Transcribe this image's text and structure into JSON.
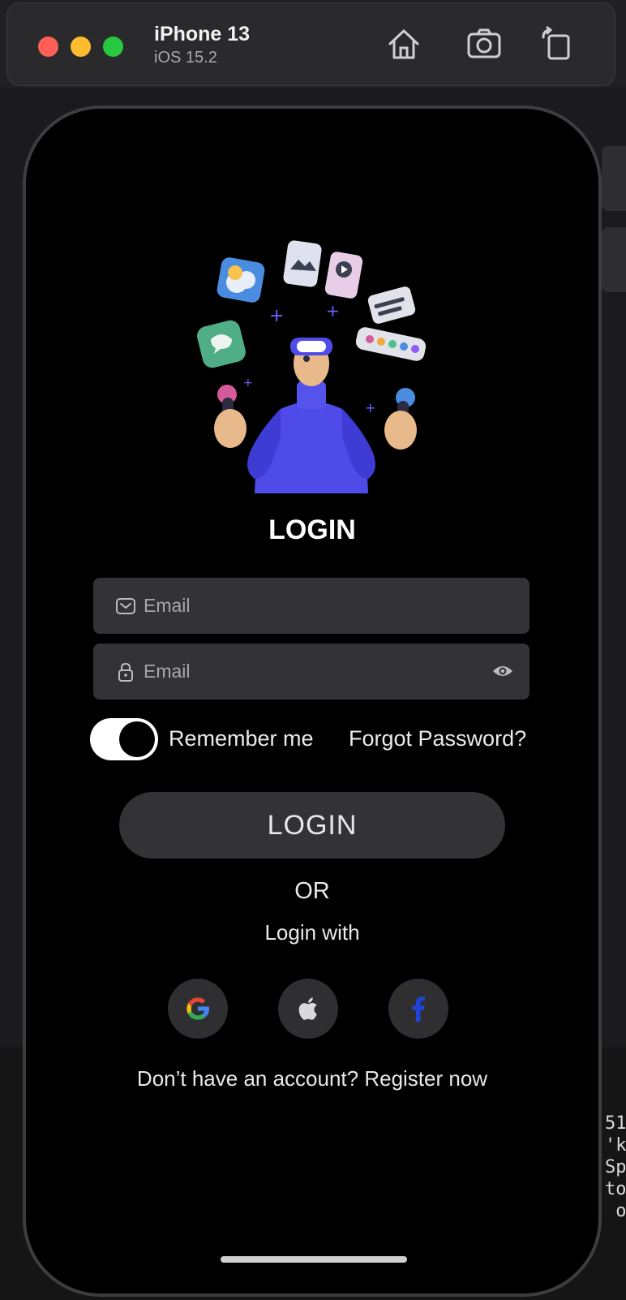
{
  "simulator": {
    "device_name": "iPhone 13",
    "os_version": "iOS 15.2"
  },
  "background": {
    "right_text_lines": [
      "51",
      "'k",
      "Spe",
      "tor",
      " or"
    ]
  },
  "app": {
    "title": "LOGIN",
    "email_field": {
      "placeholder": "Email",
      "value": ""
    },
    "password_field": {
      "placeholder": "Email",
      "value": ""
    },
    "remember_me": {
      "label": "Remember me",
      "on": true
    },
    "forgot_password": "Forgot Password?",
    "login_button": "LOGIN",
    "or_text": "OR",
    "login_with": "Login with",
    "register_text": "Don’t have an account? Register now"
  },
  "colors": {
    "screen_bg": "#000000",
    "field_bg": "#333335",
    "button_bg": "#333335",
    "text": "#e8e8e8",
    "placeholder": "#a7a7a7"
  },
  "icons": {
    "email": "envelope-icon",
    "password": "lock-icon",
    "visibility": "eye-icon",
    "social": [
      "google-icon",
      "apple-icon",
      "facebook-icon"
    ]
  }
}
